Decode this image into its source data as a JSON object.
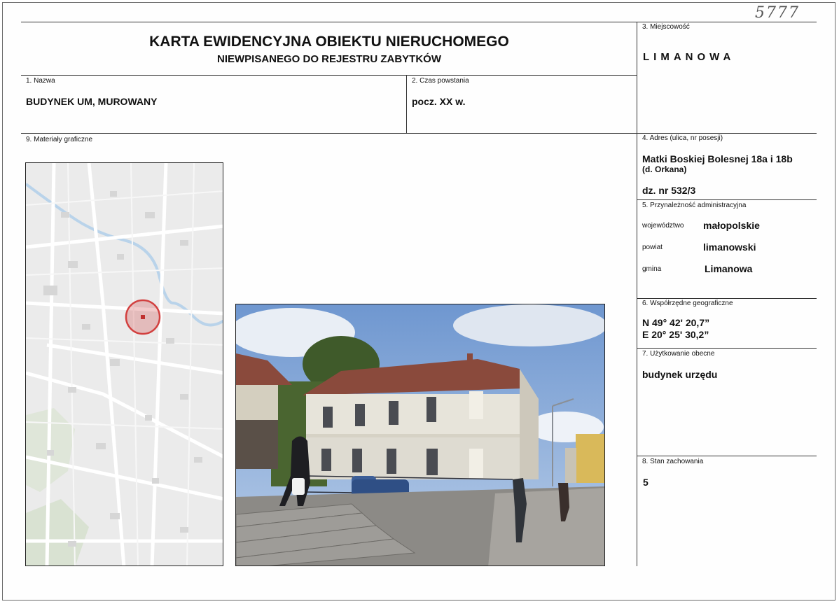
{
  "document": {
    "handwritten_number": "5777",
    "title_line1": "KARTA EWIDENCYJNA OBIEKTU NIERUCHOMEGO",
    "title_line2": "NIEWPISANEGO DO REJESTRU ZABYTKÓW"
  },
  "fields": {
    "miejscowosc": {
      "label": "3. Miejscowość",
      "value": "LIMANOWA"
    },
    "nazwa": {
      "label": "1. Nazwa",
      "value": "BUDYNEK UM, MUROWANY"
    },
    "czas": {
      "label": "2. Czas powstania",
      "value": "pocz. XX w."
    },
    "materialy": {
      "label": "9. Materiały graficzne"
    },
    "adres": {
      "label": "4. Adres (ulica, nr posesji)",
      "street": "Matki Boskiej Bolesnej 18a i 18b",
      "former": "(d. Orkana)",
      "parcel": "dz. nr 532/3"
    },
    "przynaleznosc": {
      "label": "5. Przynależność administracyjna",
      "wojewodztwo_label": "województwo",
      "wojewodztwo": "małopolskie",
      "powiat_label": "powiat",
      "powiat": "limanowski",
      "gmina_label": "gmina",
      "gmina": "Limanowa"
    },
    "wspolrzedne": {
      "label": "6. Współrzędne geograficzne",
      "n": "N 49° 42' 20,7”",
      "e": "E 20° 25' 30,2”"
    },
    "uzytkowanie": {
      "label": "7. Użytkowanie obecne",
      "value": "budynek urzędu"
    },
    "stan": {
      "label": "8. Stan zachowania",
      "value": "5"
    }
  },
  "colors": {
    "rule": "#333333",
    "marker": "#d2403f",
    "map_bg": "#ececec",
    "sky": "#7ea3d6",
    "facade": "#e7e4da",
    "roof": "#8a4a3c"
  }
}
